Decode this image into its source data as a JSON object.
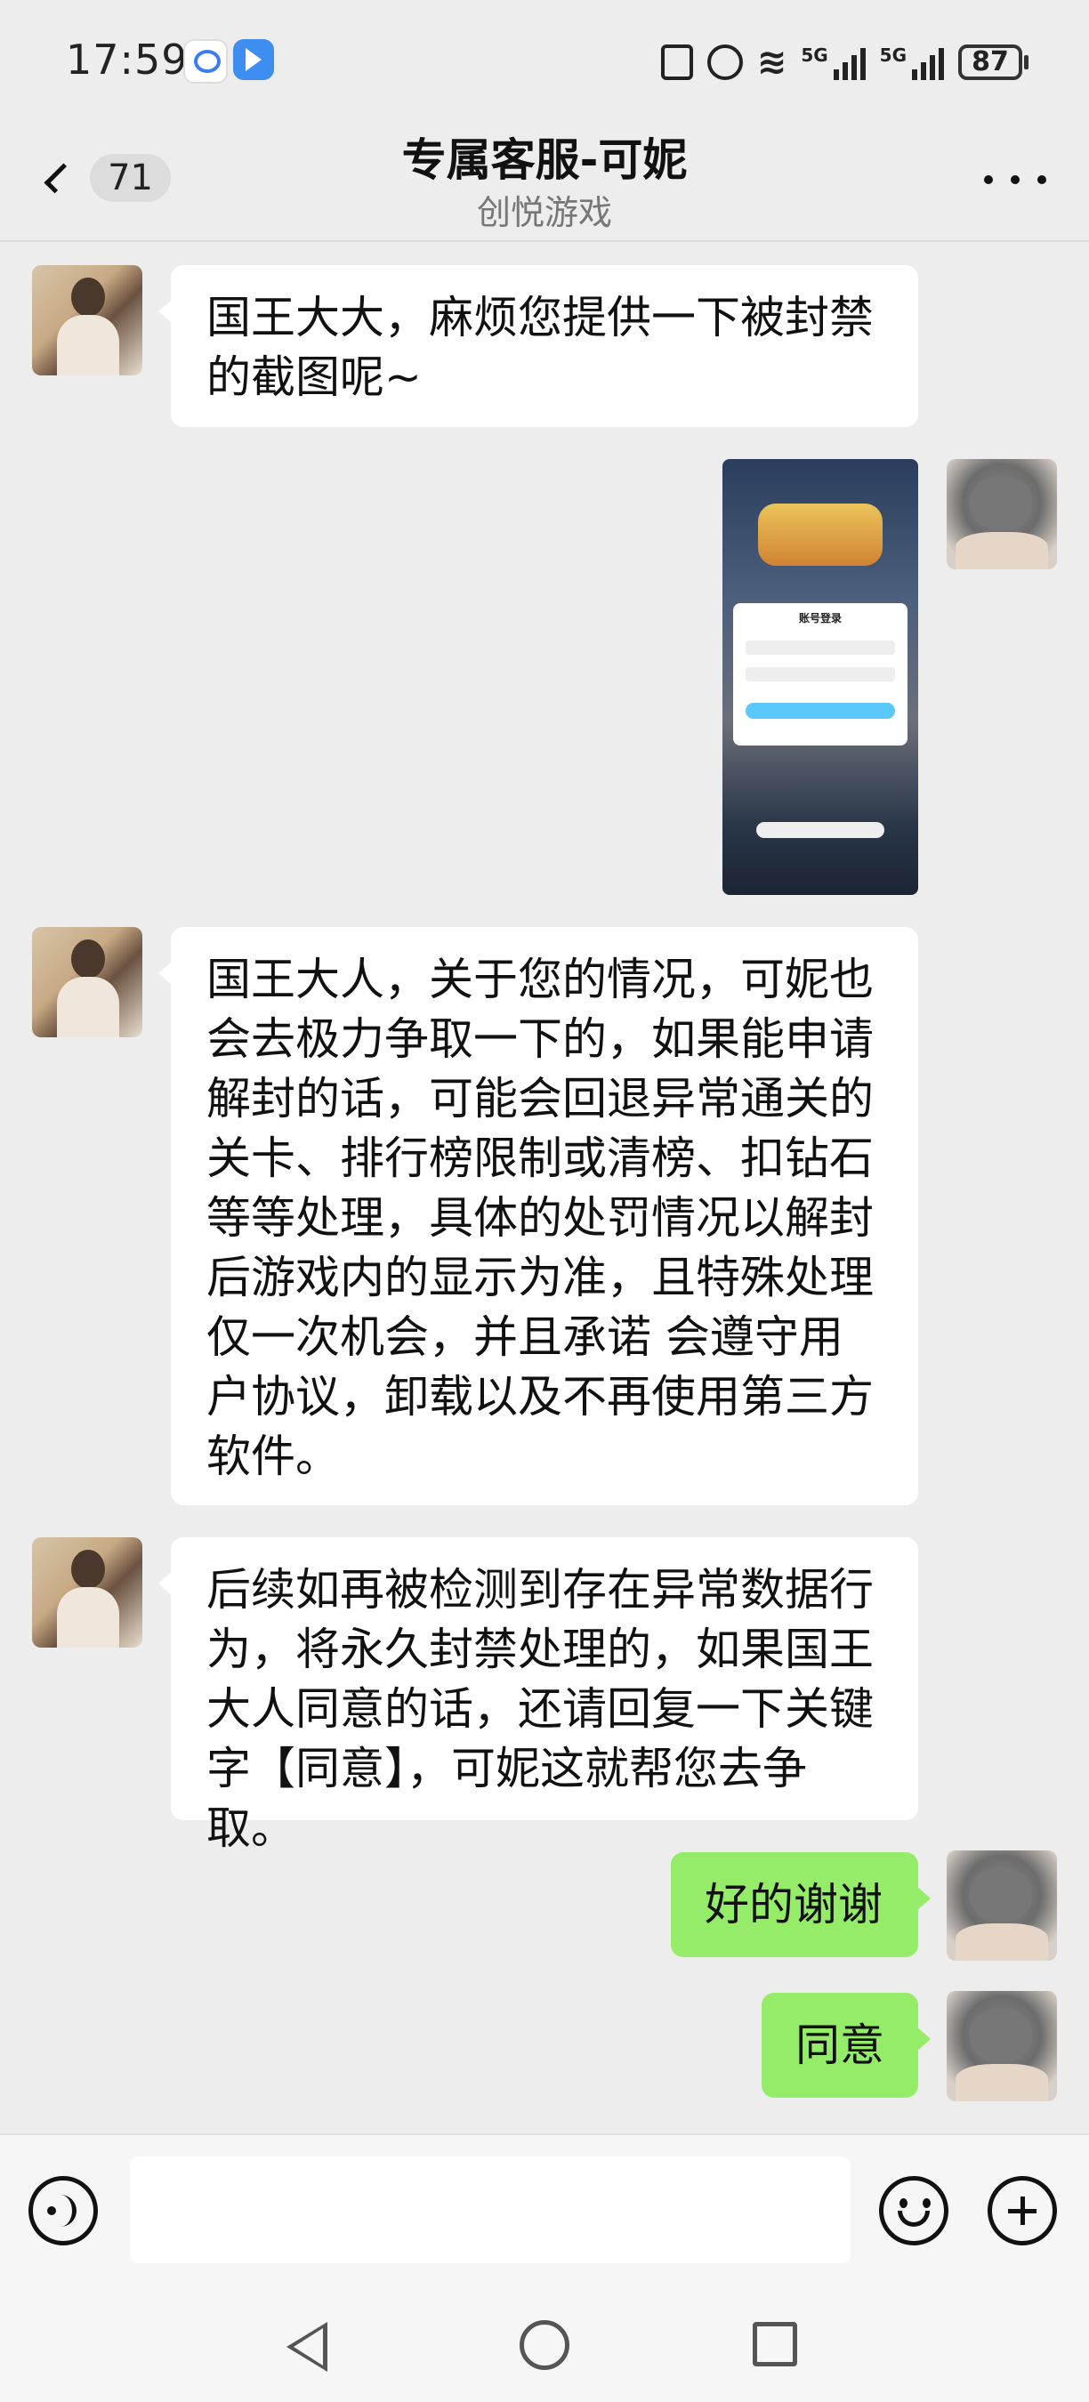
{
  "status_bar": {
    "time": "17:59",
    "battery": "87",
    "signal_1": "5G",
    "signal_2": "5G"
  },
  "header": {
    "back_count": "71",
    "title": "专属客服-可妮",
    "subtitle": "创悦游戏"
  },
  "messages": [
    {
      "side": "left",
      "text": "国王大大，麻烦您提供一下被封禁的截图呢~"
    },
    {
      "side": "right",
      "type": "image",
      "image_title": "账号登录"
    },
    {
      "side": "left",
      "text": "国王大人，关于您的情况，可妮也会去极力争取一下的，如果能申请解封的话，可能会回退异常通关的关卡、排行榜限制或清榜、扣钻石等等处理，具体的处罚情况以解封后游戏内的显示为准，且特殊处理仅一次机会，并且承诺 会遵守用户协议，卸载以及不再使用第三方软件。"
    },
    {
      "side": "left",
      "text": "后续如再被检测到存在异常数据行为，将永久封禁处理的，如果国王大人同意的话，还请回复一下关键字【同意】，可妮这就帮您去争取。"
    },
    {
      "side": "right",
      "text": "好的谢谢"
    },
    {
      "side": "right",
      "text": "同意"
    }
  ],
  "colors": {
    "background": "#ededed",
    "bubble_self": "#95ec69",
    "bubble_other": "#ffffff"
  },
  "icons": [
    "voice-icon",
    "emoji-icon",
    "plus-icon",
    "back-chevron-icon",
    "more-icon"
  ]
}
